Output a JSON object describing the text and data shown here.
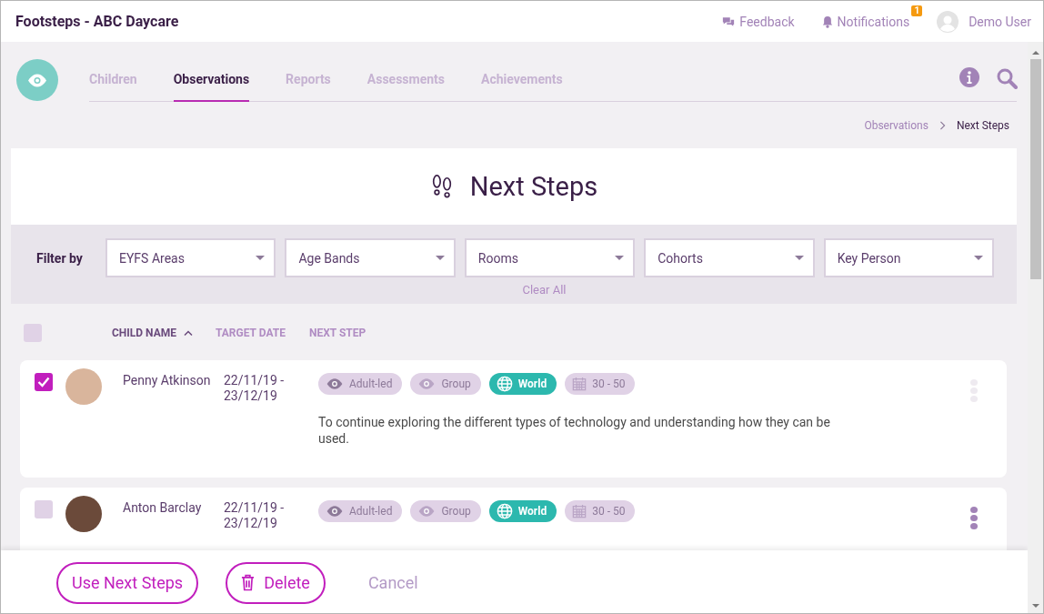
{
  "app_title": "Footsteps - ABC Daycare",
  "header_links": [
    {
      "kind": "feedback",
      "label": "Feedback"
    },
    {
      "kind": "notifications",
      "label": "Notifications",
      "badge": "1"
    },
    {
      "kind": "user",
      "label": "Demo User"
    }
  ],
  "tabs": [
    {
      "label": "Children",
      "selected": false
    },
    {
      "label": "Observations",
      "selected": true
    },
    {
      "label": "Reports",
      "selected": false
    },
    {
      "label": "Assessments",
      "selected": false
    },
    {
      "label": "Achievements",
      "selected": false
    }
  ],
  "breadcrumb": [
    {
      "label": "Observations",
      "current": false
    },
    {
      "label": "Next Steps",
      "current": true
    }
  ],
  "page_title": "Next Steps",
  "filters": {
    "label": "Filter by",
    "dropdowns": [
      "EYFS Areas",
      "Age Bands",
      "Rooms",
      "Cohorts",
      "Key Person"
    ],
    "clear": "Clear All"
  },
  "table": {
    "all_checked": false,
    "columns": [
      {
        "label": "CHILD NAME",
        "sorted": true
      },
      {
        "label": "TARGET DATE",
        "sorted": false
      },
      {
        "label": "NEXT STEP",
        "sorted": false
      }
    ],
    "rows": [
      {
        "checked": true,
        "name": "Penny Atkinson",
        "date": "22/11/19 - 23/12/19",
        "menu_active": false,
        "tags": [
          {
            "kind": "eye",
            "label": "Adult-led",
            "active": false
          },
          {
            "kind": "eye-faded",
            "label": "Group",
            "active": false
          },
          {
            "kind": "globe",
            "label": "World",
            "active": true
          },
          {
            "kind": "calendar",
            "label": "30 - 50",
            "active": false
          }
        ],
        "text": "To continue exploring the different types of technology and understanding how they can be used."
      },
      {
        "checked": false,
        "name": "Anton Barclay",
        "date": "22/11/19 - 23/12/19",
        "menu_active": true,
        "tags": [
          {
            "kind": "eye",
            "label": "Adult-led",
            "active": false
          },
          {
            "kind": "eye-faded",
            "label": "Group",
            "active": false
          },
          {
            "kind": "globe",
            "label": "World",
            "active": true
          },
          {
            "kind": "calendar",
            "label": "30 - 50",
            "active": false
          }
        ],
        "text": ""
      }
    ]
  },
  "actions": [
    {
      "kind": "outline",
      "label": "Use Next Steps"
    },
    {
      "kind": "delete",
      "label": "Delete"
    },
    {
      "kind": "text",
      "label": "Cancel"
    }
  ]
}
